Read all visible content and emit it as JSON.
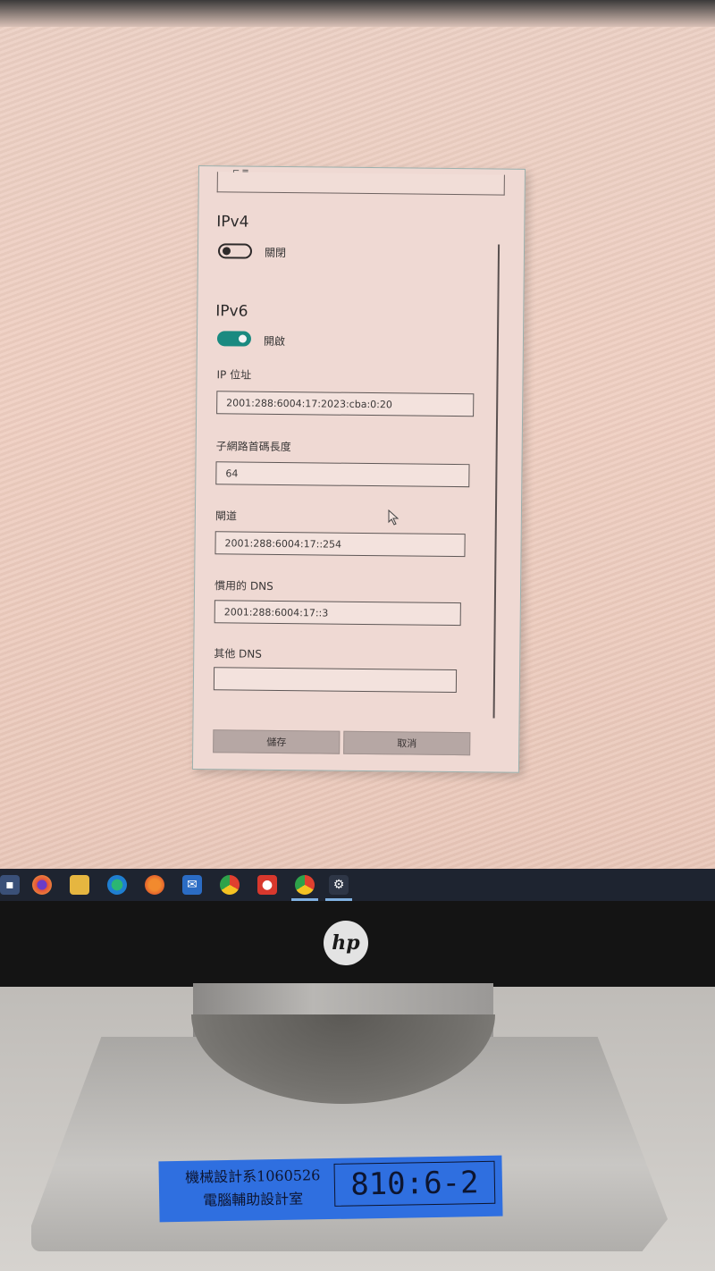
{
  "dialog": {
    "ipv4": {
      "title": "IPv4",
      "toggle_state": "關閉",
      "enabled": false
    },
    "ipv6": {
      "title": "IPv6",
      "toggle_state": "開啟",
      "enabled": true
    },
    "fields": [
      {
        "label": "IP 位址",
        "value": "2001:288:6004:17:2023:cba:0:20"
      },
      {
        "label": "子網路首碼長度",
        "value": "64"
      },
      {
        "label": "閘道",
        "value": "2001:288:6004:17::254"
      },
      {
        "label": "慣用的 DNS",
        "value": "2001:288:6004:17::3"
      },
      {
        "label": "其他 DNS",
        "value": ""
      }
    ],
    "buttons": {
      "save": "儲存",
      "cancel": "取消"
    }
  },
  "taskbar": {
    "icons": [
      "app-icon",
      "firefox-icon",
      "file-explorer-icon",
      "edge-icon",
      "firefox-icon",
      "mail-icon",
      "chrome-icon",
      "app-red-icon",
      "chrome-icon",
      "settings-icon"
    ]
  },
  "monitor": {
    "brand": "hp"
  },
  "sticker": {
    "line1": "機械設計系1060526",
    "line2": "電腦輔助設計室",
    "room": "810:6-2"
  },
  "colors": {
    "toggle_on": "#1a8a80",
    "taskbar": "#1e2430",
    "sticker": "#2f6fe0"
  }
}
